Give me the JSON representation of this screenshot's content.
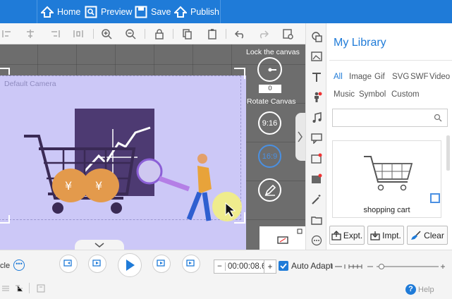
{
  "topbar": {
    "home": "Home",
    "preview": "Preview",
    "save": "Save",
    "publish": "Publish"
  },
  "canvas": {
    "camera_label": "Default Camera",
    "lock_label": "Lock the canvas",
    "rotate_value": "0",
    "rotate_label": "Rotate Canvas",
    "ratio_916": "9:16",
    "ratio_169": "16:9"
  },
  "library": {
    "title": "My Library",
    "tabs_row1": [
      "All",
      "Image",
      "Gif",
      "SVG",
      "SWF",
      "Video"
    ],
    "tabs_row2": [
      "Music",
      "Symbol",
      "Custom"
    ],
    "item_label": "shopping cart",
    "export": "Expt.",
    "import": "Impt.",
    "clear": "Clear"
  },
  "bottom": {
    "left_fragment": "cle",
    "time": "00:00:08.6",
    "auto_adapt": "Auto Adapt",
    "help": "Help"
  },
  "colors": {
    "brand": "#1f7bd8",
    "stage": "#ccc8f7",
    "canvas_bg": "#6d6d6d"
  }
}
